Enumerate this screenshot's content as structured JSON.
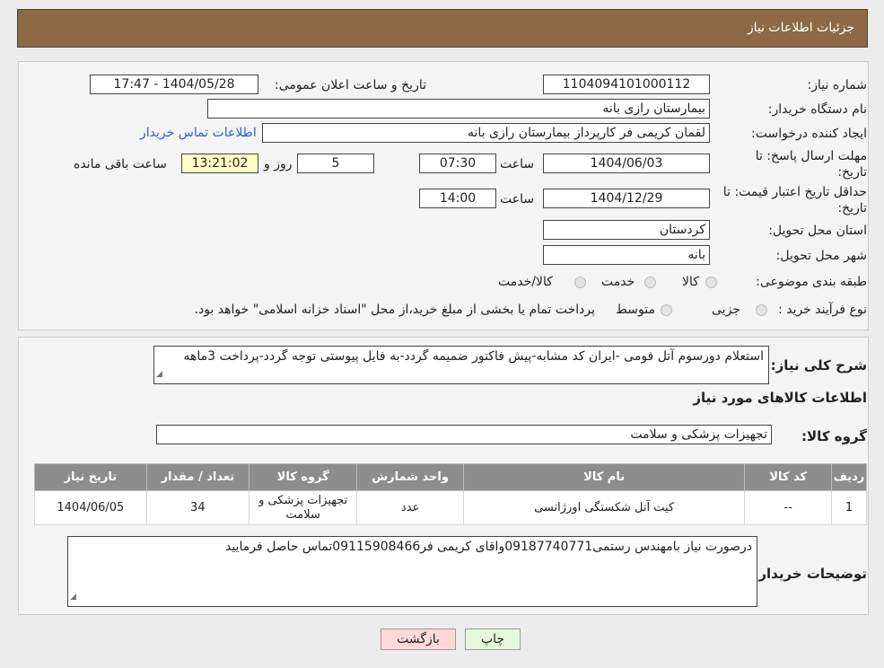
{
  "header": {
    "title": "جزئیات اطلاعات نیاز"
  },
  "form": {
    "need_number": {
      "label": "شماره نیاز:",
      "value": "1104094101000112"
    },
    "announce": {
      "label": "تاریخ و ساعت اعلان عمومی:",
      "value": "1404/05/28 - 17:47"
    },
    "buyer_org": {
      "label": "نام دستگاه خریدار:",
      "value": "بیمارستان رازی بانه"
    },
    "requester": {
      "label": "ایجاد کننده درخواست:",
      "value": "لقمان کریمی فر کارپرداز بیمارستان رازی بانه",
      "contact_link": "اطلاعات تماس خریدار"
    },
    "reply_deadline": {
      "label_line1": "مهلت ارسال پاسخ: تا",
      "label_line2": "تاریخ:",
      "date": "1404/06/03",
      "time_label": "ساعت",
      "time": "07:30",
      "days": "5",
      "days_label": "روز و",
      "remaining": "13:21:02",
      "remaining_label": "ساعت باقی مانده"
    },
    "price_validity": {
      "label_line1": "حداقل تاریخ اعتبار قیمت: تا",
      "label_line2": "تاریخ:",
      "date": "1404/12/29",
      "time_label": "ساعت",
      "time": "14:00"
    },
    "province": {
      "label": "استان محل تحویل:",
      "value": "کردستان"
    },
    "city": {
      "label": "شهر محل تحویل:",
      "value": "بانه"
    },
    "category": {
      "label": "طبقه بندی موضوعی:",
      "options": [
        "کالا",
        "خدمت",
        "کالا/خدمت"
      ]
    },
    "purchase_type": {
      "label": "نوع فرآیند خرید :",
      "options": [
        "جزیی",
        "متوسط"
      ],
      "note": "پرداخت تمام یا بخشی از مبلغ خرید،از محل \"اسناد خزانه اسلامی\" خواهد بود."
    }
  },
  "details": {
    "description_label": "شرح کلی نیاز:",
    "description": "استعلام دورسوم آتل فومی -ایران کد مشابه-پیش فاکتور ضمیمه گردد-به فایل پیوستی توجه گردد-پرداخت 3ماهه",
    "goods_info_title": "اطلاعات کالاهای مورد نیاز",
    "goods_group_label": "گروه کالا:",
    "goods_group": "تجهیزات پزشکی و سلامت",
    "table": {
      "headers": [
        "ردیف",
        "کد کالا",
        "نام کالا",
        "واحد شمارش",
        "گروه کالا",
        "تعداد / مقدار",
        "تاریخ نیاز"
      ],
      "rows": [
        [
          "1",
          "--",
          "کیت آتل شکستگی اورژانسی",
          "عدد",
          "تجهیزات پزشکی و سلامت",
          "34",
          "1404/06/05"
        ]
      ]
    },
    "buyer_notes_label": "توضیحات خریدار:",
    "buyer_notes": "درصورت نیاز بامهندس رستمی09187740771واقای کریمی فر09115908466تماس حاصل فرمایید"
  },
  "buttons": {
    "print": "چاپ",
    "back": "بازگشت"
  },
  "colors": {
    "header_bg": "#8b6a45",
    "table_header_bg": "#8d8d8d",
    "remaining_bg": "#ffffc4",
    "back_button_bg": "#ffd9d9",
    "print_button_bg": "#e4f9dc",
    "link": "#2a63c8"
  }
}
